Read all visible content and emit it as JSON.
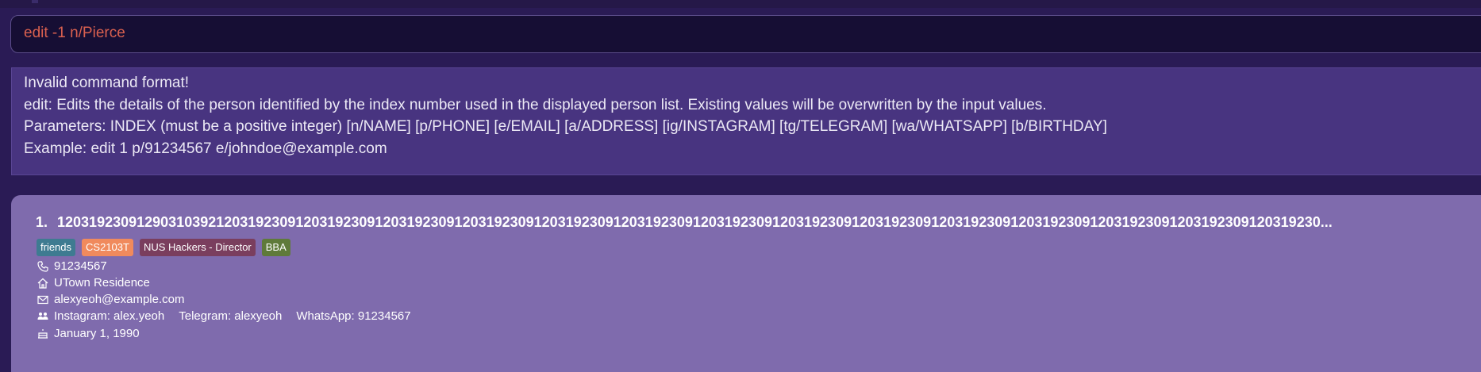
{
  "command_box": {
    "value": "edit -1 n/Pierce"
  },
  "result_display": {
    "lines": [
      "Invalid command format!",
      "edit: Edits the details of the person identified by the index number used in the displayed person list. Existing values will be overwritten by the input values.",
      "Parameters: INDEX (must be a positive integer) [n/NAME] [p/PHONE] [e/EMAIL] [a/ADDRESS] [ig/INSTAGRAM] [tg/TELEGRAM] [wa/WHATSAPP] [b/BIRTHDAY]",
      "Example: edit 1 p/91234567 e/johndoe@example.com"
    ]
  },
  "person_list": {
    "cards": [
      {
        "index": "1.",
        "name": "120319230912903103921203192309120319230912031923091203192309120319230912031923091203192309120319230912031923091203192309120319230912031923091203192309120319230...",
        "tags": [
          {
            "label": "friends",
            "color": "#3e7b91"
          },
          {
            "label": "CS2103T",
            "color": "#f08a5d"
          },
          {
            "label": "NUS Hackers - Director",
            "color": "#7a3e5e"
          },
          {
            "label": "BBA",
            "color": "#5f7a3a"
          }
        ],
        "phone": "91234567",
        "address": "UTown Residence",
        "email": "alexyeoh@example.com",
        "instagram": "Instagram: alex.yeoh",
        "telegram": "Telegram: alexyeoh",
        "whatsapp": "WhatsApp: 91234567",
        "birthday": "January 1, 1990",
        "icons": {
          "phone": "phone-icon",
          "address": "home-icon",
          "email": "mail-icon",
          "social": "people-icon",
          "birthday": "cake-icon"
        }
      }
    ]
  },
  "colors": {
    "background": "#2a1b55",
    "command_text": "#d9604f",
    "result_background": "#483480",
    "card_background": "#7f6bad"
  }
}
